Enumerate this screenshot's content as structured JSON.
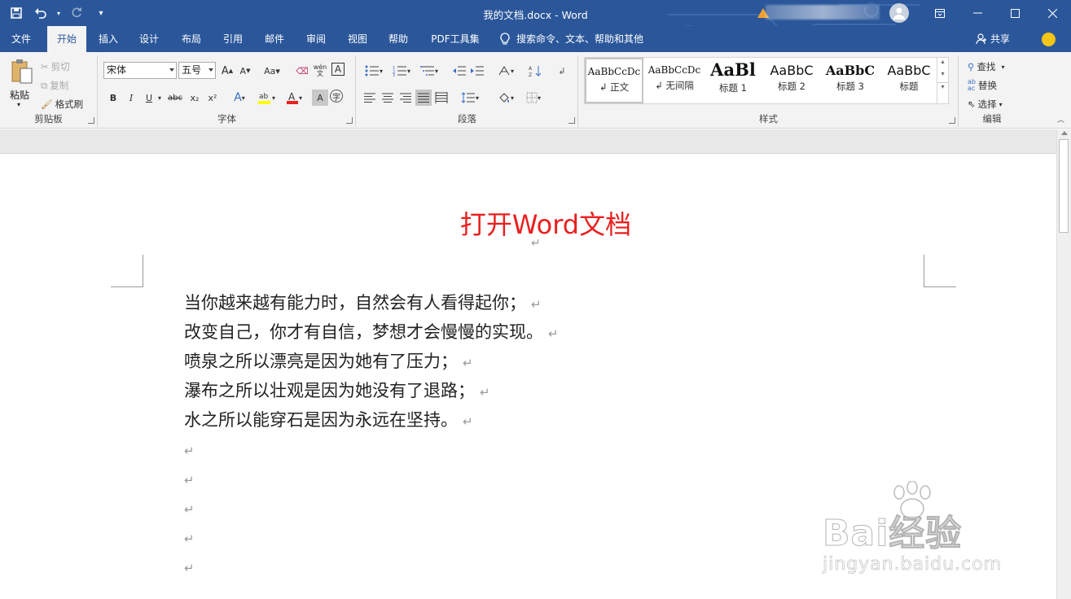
{
  "window": {
    "title": "我的文档.docx  -  Word"
  },
  "qat": {
    "save_icon": "save-icon",
    "undo_icon": "undo-icon",
    "redo_icon": "redo-icon",
    "customize_icon": "customize-qat-icon"
  },
  "window_controls": [
    "ribbon-display-options",
    "minimize",
    "maximize",
    "close"
  ],
  "tabs": [
    "文件",
    "开始",
    "插入",
    "设计",
    "布局",
    "引用",
    "邮件",
    "审阅",
    "视图",
    "帮助",
    "PDF工具集"
  ],
  "active_tab": "开始",
  "tell_me": "搜索命令、文本、帮助和其他",
  "share": "共享",
  "clipboard": {
    "paste": "粘贴",
    "cut": "剪切",
    "copy": "复制",
    "format_painter": "格式刷",
    "label": "剪贴板"
  },
  "font": {
    "name": "宋体",
    "size": "五号",
    "grow": "A",
    "shrink": "A",
    "case": "Aa",
    "phonetic": "wén",
    "bold": "B",
    "italic": "I",
    "underline": "U",
    "strike": "abc",
    "subscript": "x₂",
    "superscript": "x²",
    "label": "字体",
    "font_color": "#e8201f",
    "highlight_color": "#ffff00"
  },
  "paragraph": {
    "label": "段落"
  },
  "styles": {
    "label": "样式",
    "items": [
      {
        "sample": "AaBbCcDc",
        "name": "↲ 正文"
      },
      {
        "sample": "AaBbCcDc",
        "name": "↲ 无间隔"
      },
      {
        "sample": "AaBl",
        "name": "标题 1"
      },
      {
        "sample": "AaBbC",
        "name": "标题 2"
      },
      {
        "sample": "AaBbC",
        "name": "标题 3"
      },
      {
        "sample": "AaBbC",
        "name": "标题"
      }
    ]
  },
  "editing": {
    "find": "查找",
    "replace": "替换",
    "select": "选择",
    "label": "编辑"
  },
  "document": {
    "title": "打开Word文档",
    "title_color": "#e8201f",
    "paragraph_mark": "↵",
    "lines": [
      "当你越来越有能力时，自然会有人看得起你；",
      "改变自己，你才有自信，梦想才会慢慢的实现。",
      "喷泉之所以漂亮是因为她有了压力；",
      "瀑布之所以壮观是因为她没有了退路；",
      "水之所以能穿石是因为永远在坚持。",
      "",
      "",
      "",
      "",
      "",
      ""
    ]
  },
  "watermark": {
    "main": "Bai经验",
    "sub": "jingyan.baidu.com"
  },
  "colors": {
    "brand": "#2b579a",
    "ribbon": "#f3f3f3"
  }
}
